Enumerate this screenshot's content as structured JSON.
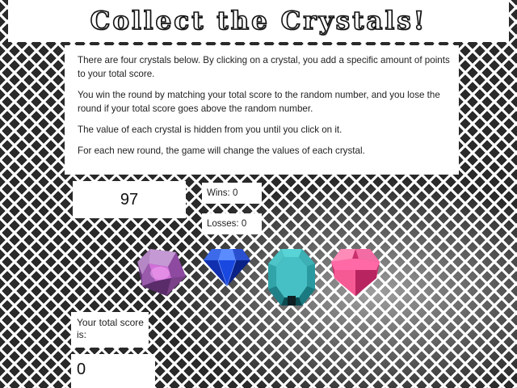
{
  "title": "Collect the Crystals!",
  "instructions": [
    "There are four crystals below. By clicking on a crystal, you add a specific amount of points to your total score.",
    "You win the round by matching your total score to the random number, and you lose the round if your total score goes above the random number.",
    "The value of each crystal is hidden from you until you click on it.",
    "For each new round, the game will change the values of each crystal."
  ],
  "target_number": "97",
  "wins": "Wins: 0",
  "losses": "Losses: 0",
  "crystals": [
    {
      "name": "purple-crystal",
      "color": "#a05ab4"
    },
    {
      "name": "blue-crystal",
      "color": "#1540c8"
    },
    {
      "name": "teal-crystal",
      "color": "#3cbcc0"
    },
    {
      "name": "pink-crystal",
      "color": "#f0508c"
    }
  ],
  "score_label": "Your total score is:",
  "total_score": "0"
}
